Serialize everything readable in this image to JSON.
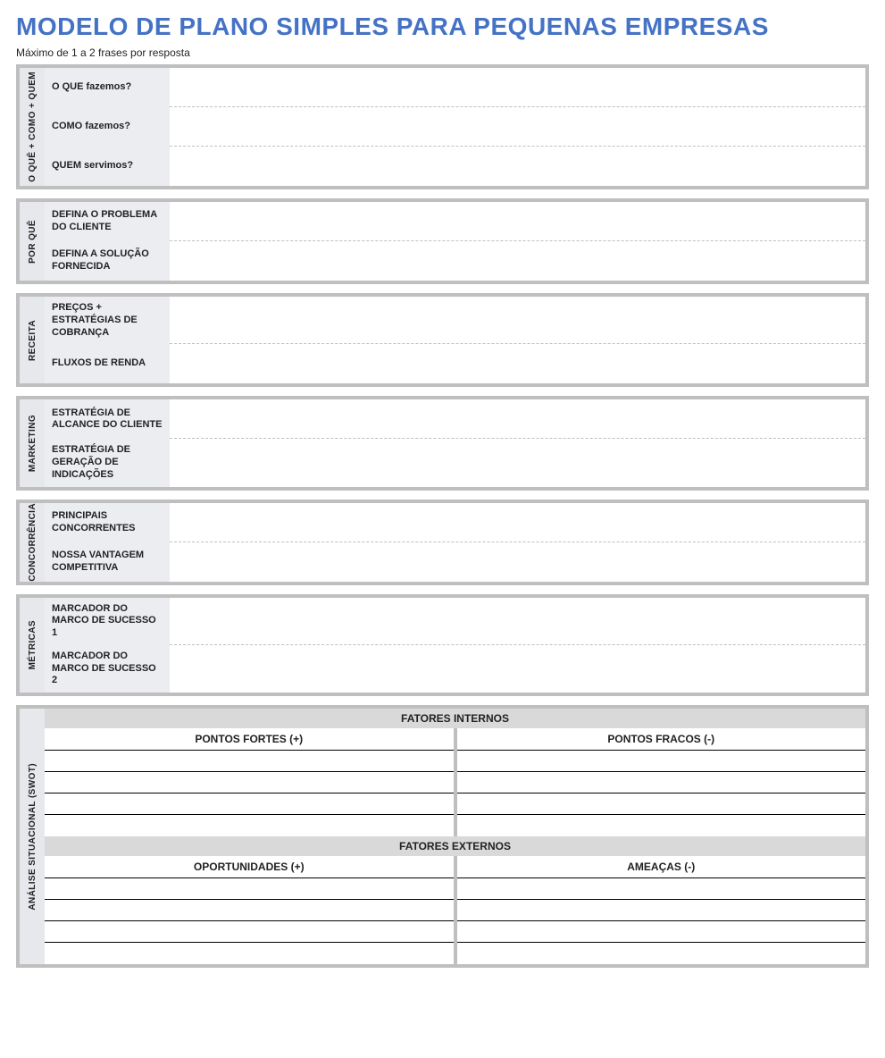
{
  "title": "MODELO DE PLANO SIMPLES PARA PEQUENAS EMPRESAS",
  "subtitle": "Máximo de 1 a 2 frases por resposta",
  "sections": [
    {
      "id": "what-how-who",
      "vlabel": "O QUÊ + COMO + QUEM",
      "rows": [
        {
          "id": "what-we-do",
          "label": "O QUE fazemos?",
          "value": ""
        },
        {
          "id": "how-we-do",
          "label": "COMO fazemos?",
          "value": ""
        },
        {
          "id": "who-we-serve",
          "label": "QUEM servimos?",
          "value": ""
        }
      ]
    },
    {
      "id": "why",
      "vlabel": "POR QUÊ",
      "rows": [
        {
          "id": "customer-problem",
          "label": "DEFINA O PROBLEMA DO CLIENTE",
          "value": ""
        },
        {
          "id": "solution-provided",
          "label": "DEFINA A SOLUÇÃO FORNECIDA",
          "value": ""
        }
      ]
    },
    {
      "id": "revenue",
      "vlabel": "RECEITA",
      "rows": [
        {
          "id": "pricing-billing",
          "label": "PREÇOS + ESTRATÉGIAS DE COBRANÇA",
          "value": ""
        },
        {
          "id": "income-streams",
          "label": "FLUXOS DE RENDA",
          "value": ""
        }
      ]
    },
    {
      "id": "marketing",
      "vlabel": "MARKETING",
      "rows": [
        {
          "id": "reach-strategy",
          "label": "ESTRATÉGIA DE ALCANCE DO CLIENTE",
          "value": ""
        },
        {
          "id": "referral-strategy",
          "label": "ESTRATÉGIA DE GERAÇÃO DE INDICAÇÕES",
          "value": ""
        }
      ]
    },
    {
      "id": "competition",
      "vlabel": "CONCORRÊNCIA",
      "rows": [
        {
          "id": "main-competitors",
          "label": "PRINCIPAIS CONCORRENTES",
          "value": ""
        },
        {
          "id": "competitive-advantage",
          "label": "NOSSA VANTAGEM COMPETITIVA",
          "value": ""
        }
      ]
    },
    {
      "id": "metrics",
      "vlabel": "MÉTRICAS",
      "rows": [
        {
          "id": "milestone-1",
          "label": "MARCADOR DO MARCO DE SUCESSO 1",
          "value": ""
        },
        {
          "id": "milestone-2",
          "label": "MARCADOR DO MARCO DE SUCESSO 2",
          "value": ""
        }
      ]
    }
  ],
  "swot": {
    "vlabel": "ANÁLISE SITUACIONAL (SWOT)",
    "internal": {
      "title": "FATORES INTERNOS",
      "left": {
        "header": "PONTOS FORTES (+)",
        "items": [
          "",
          "",
          "",
          ""
        ]
      },
      "right": {
        "header": "PONTOS FRACOS (-)",
        "items": [
          "",
          "",
          "",
          ""
        ]
      }
    },
    "external": {
      "title": "FATORES EXTERNOS",
      "left": {
        "header": "OPORTUNIDADES (+)",
        "items": [
          "",
          "",
          "",
          ""
        ]
      },
      "right": {
        "header": "AMEAÇAS (-)",
        "items": [
          "",
          "",
          "",
          ""
        ]
      }
    }
  }
}
